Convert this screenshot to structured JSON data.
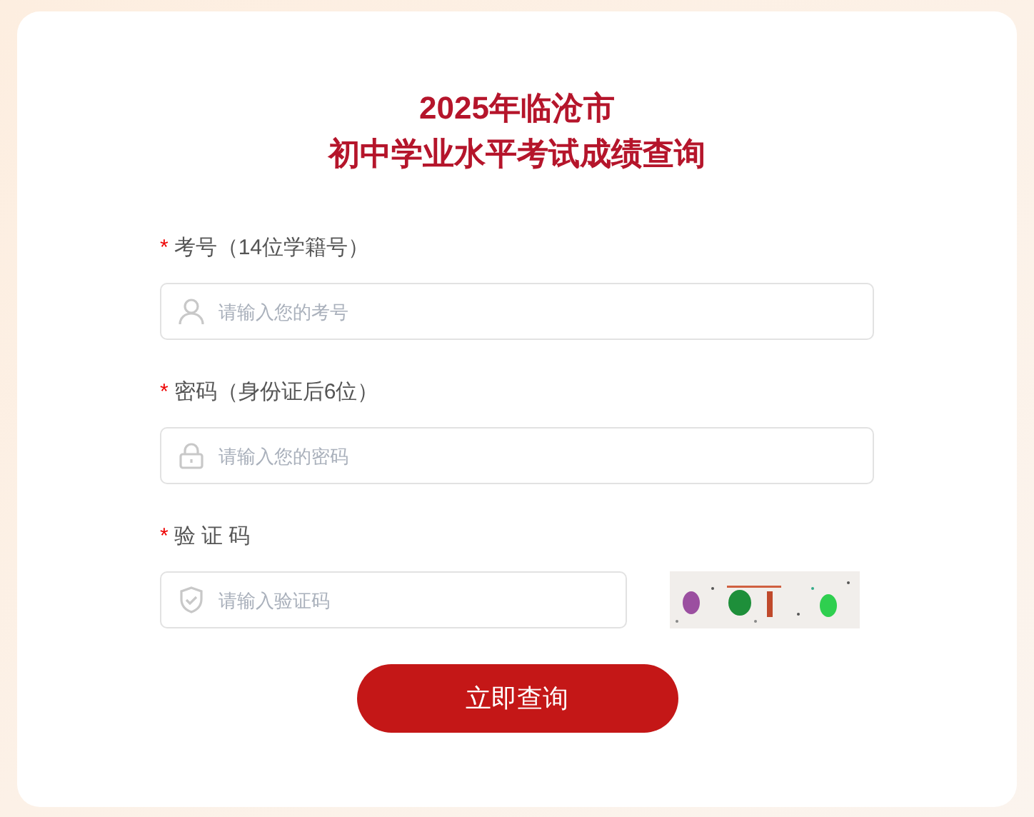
{
  "title": [
    "2025年临沧市",
    "初中学业水平考试成绩查询"
  ],
  "fields": [
    {
      "kind": "user",
      "required_mark": "*",
      "label": "考号（14位学籍号）",
      "placeholder": "请输入您的考号"
    },
    {
      "kind": "lock",
      "required_mark": "*",
      "label": "密码（身份证后6位）",
      "placeholder": "请输入您的密码"
    },
    {
      "kind": "captcha",
      "required_mark": "*",
      "label": "验 证 码",
      "placeholder": "请输入验证码"
    }
  ],
  "submit_button": "立即查询"
}
